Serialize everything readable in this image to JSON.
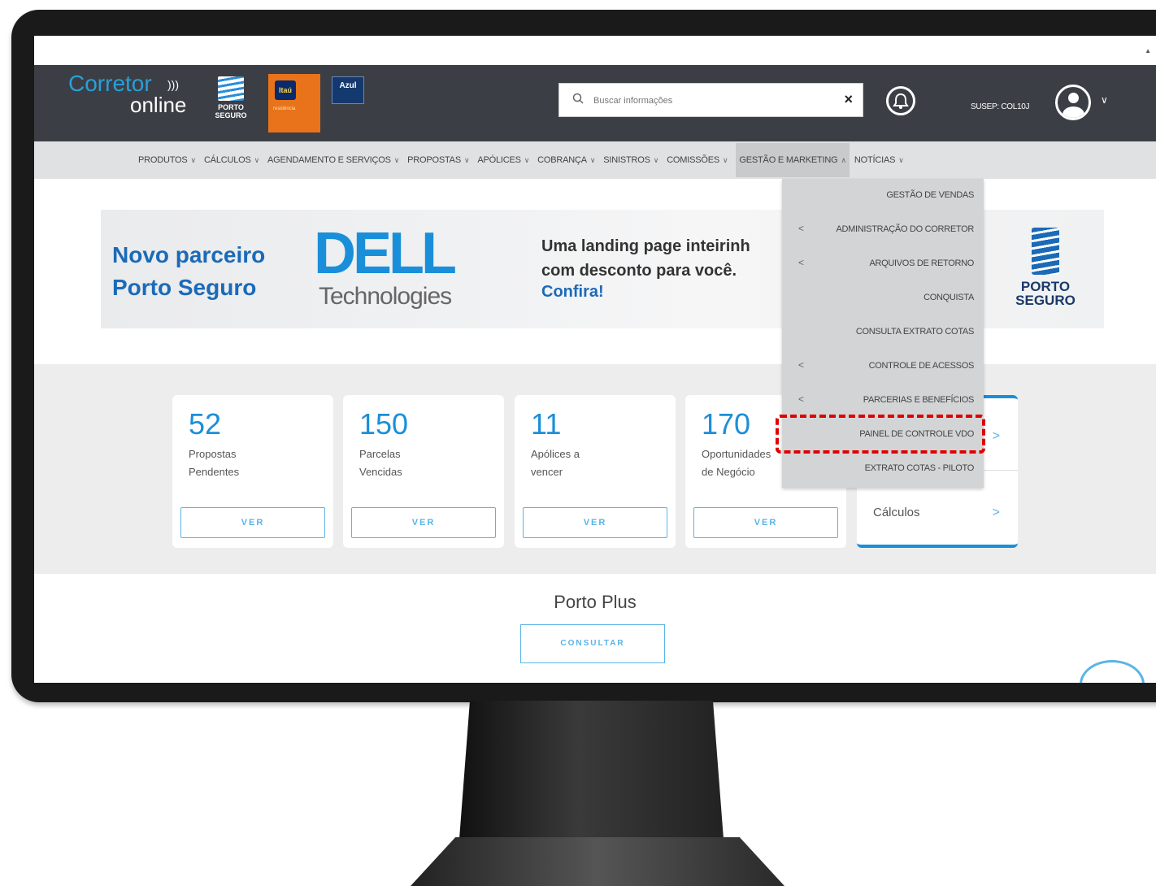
{
  "brand": {
    "logo_main": "Corretor",
    "logo_sub": "online",
    "porto_badge": "PORTO SEGURO",
    "itau_badge": "Itaú",
    "itau_sub": "residência",
    "azul_badge": "Azul"
  },
  "search": {
    "placeholder": "Buscar informações",
    "clear": "×"
  },
  "user": {
    "susep": "SUSEP: COL10J"
  },
  "menu": [
    {
      "label": "PRODUTOS",
      "expanded": false
    },
    {
      "label": "CÁLCULOS",
      "expanded": false
    },
    {
      "label": "AGENDAMENTO E SERVIÇOS",
      "expanded": false
    },
    {
      "label": "PROPOSTAS",
      "expanded": false
    },
    {
      "label": "APÓLICES",
      "expanded": false
    },
    {
      "label": "COBRANÇA",
      "expanded": false
    },
    {
      "label": "SINISTROS",
      "expanded": false
    },
    {
      "label": "COMISSÕES",
      "expanded": false
    },
    {
      "label": "GESTÃO E MARKETING",
      "expanded": true
    },
    {
      "label": "NOTÍCIAS",
      "expanded": false
    }
  ],
  "dropdown": [
    {
      "label": "GESTÃO DE VENDAS",
      "submenu": false
    },
    {
      "label": "ADMINISTRAÇÃO DO CORRETOR",
      "submenu": true
    },
    {
      "label": "ARQUIVOS DE RETORNO",
      "submenu": true
    },
    {
      "label": "CONQUISTA",
      "submenu": false
    },
    {
      "label": "CONSULTA EXTRATO COTAS",
      "submenu": false
    },
    {
      "label": "CONTROLE DE ACESSOS",
      "submenu": true
    },
    {
      "label": "PARCERIAS E BENEFÍCIOS",
      "submenu": true
    },
    {
      "label": "PAINEL DE CONTROLE VDO",
      "submenu": false,
      "highlighted": true
    },
    {
      "label": "EXTRATO COTAS - PILOTO",
      "submenu": false
    }
  ],
  "banner": {
    "left_line1": "Novo parceiro",
    "left_line2": "Porto Seguro",
    "dell": "DELL",
    "technologies": "Technologies",
    "mid_line1": "Uma landing page inteirinh",
    "mid_line2": "com desconto para você.",
    "cta": "Confira!",
    "porto_line1": "PORTO",
    "porto_line2": "SEGURO"
  },
  "cards": [
    {
      "count": "52",
      "line1": "Propostas",
      "line2": "Pendentes",
      "button": "VER"
    },
    {
      "count": "150",
      "line1": "Parcelas",
      "line2": "Vencidas",
      "button": "VER"
    },
    {
      "count": "11",
      "line1": "Apólices a",
      "line2": "vencer",
      "button": "VER"
    },
    {
      "count": "170",
      "line1": "Oportunidades",
      "line2": "de Negócio",
      "button": "VER"
    }
  ],
  "side_card": {
    "item": "Cálculos"
  },
  "porto_plus": {
    "title": "Porto Plus",
    "button": "CONSULTAR"
  },
  "colors": {
    "accent": "#1a8fd9",
    "header_bg": "#3b3f45",
    "highlight": "#e00000"
  }
}
